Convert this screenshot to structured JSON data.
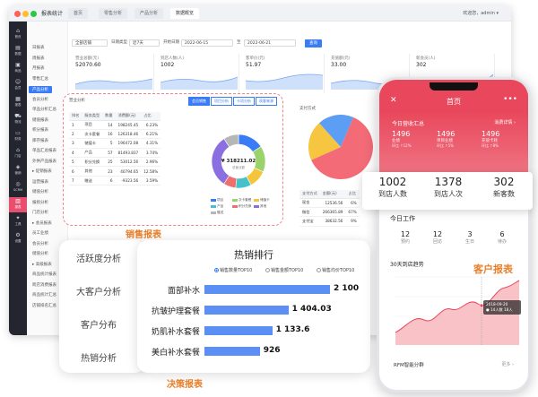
{
  "window": {
    "app_title": "报表统计",
    "tabs": [
      "首页",
      "零售分析",
      "产品分析",
      "数据概览"
    ],
    "user": "欢迎您，admin ▾",
    "colors": {
      "accent": "#3a7bf6",
      "sidebar": "#23262e",
      "sidebar_active": "#e84f6f"
    }
  },
  "sidebar": {
    "items": [
      {
        "icon": "home-icon",
        "glyph": "⌂",
        "label": "首页"
      },
      {
        "icon": "chart-icon",
        "glyph": "▤",
        "label": "数据"
      },
      {
        "icon": "cart-icon",
        "glyph": "▣",
        "label": "商品"
      },
      {
        "icon": "users-icon",
        "glyph": "☺",
        "label": "会员"
      },
      {
        "icon": "doc-icon",
        "glyph": "▦",
        "label": "报表"
      },
      {
        "icon": "truck-icon",
        "glyph": "⛟",
        "label": "物流"
      },
      {
        "icon": "card-icon",
        "glyph": "▭",
        "label": "财务"
      },
      {
        "icon": "shop-icon",
        "glyph": "⌂",
        "label": "门店"
      },
      {
        "icon": "tag-icon",
        "glyph": "◈",
        "label": "营销"
      },
      {
        "icon": "crm-icon",
        "glyph": "◎",
        "label": "SCRM"
      },
      {
        "icon": "report-icon",
        "glyph": "▥",
        "label": "报表"
      },
      {
        "icon": "tool-icon",
        "glyph": "✦",
        "label": "工具"
      },
      {
        "icon": "gear-icon",
        "glyph": "⚙",
        "label": "设置"
      }
    ],
    "active_index": 10
  },
  "subnav": {
    "items": [
      "日报表",
      "周报表",
      "月报表",
      "零售汇总",
      "产品分析",
      "会员分析",
      "单品分析汇总",
      "储值报表",
      "积分报表",
      "库存报表",
      "单品汇总报表",
      "外供产品报表",
      "▸ 促销报表",
      "运营报表",
      "储值分析",
      "报损分析",
      "门店分析",
      "▸ 会员报表",
      "员工业绩",
      "会员分析",
      "储值分析",
      "▸ 高级报表",
      "商品统计报表",
      "跨店消费报表",
      "商品统计汇总",
      "店铺排名汇总"
    ],
    "active_index": 4
  },
  "filters": {
    "shop": "全部店铺",
    "period_label": "日期类型",
    "period": "近7天",
    "date_label": "开始日期",
    "start": "2022-06-15",
    "end_label": "至",
    "end": "2022-06-21",
    "query": "查询"
  },
  "kpis": [
    {
      "title": "营业总额(元)",
      "value": "52070.60"
    },
    {
      "title": "到店人数(人)",
      "value": "1002"
    },
    {
      "title": "客单价(元)",
      "value": "51.97"
    },
    {
      "title": "充值额(元)",
      "value": "33.00"
    },
    {
      "title": "新会员(人)",
      "value": "302"
    }
  ],
  "sales": {
    "title": "营业分析",
    "tabs": [
      "会员销售",
      "项目分析",
      "卡项分析",
      "获客来源"
    ],
    "columns": [
      "排名",
      "服务类型",
      "数量",
      "消费额(元)",
      "占比"
    ],
    "rows": [
      [
        "1",
        "项目",
        "14",
        "198245.45",
        "6.23%"
      ],
      [
        "2",
        "次卡套餐",
        "16",
        "126318.46",
        "6.21%"
      ],
      [
        "3",
        "储值卡",
        "5",
        "196472.08",
        "4.31%"
      ],
      [
        "4",
        "产品",
        "57",
        "81493.837",
        "3.74%"
      ],
      [
        "5",
        "积分兑换",
        "25",
        "53012.56",
        "2.96%"
      ],
      [
        "6",
        "其他",
        "23",
        "40794.65",
        "12.58%"
      ],
      [
        "7",
        "赠送",
        "6",
        "-9323.56",
        "3.59%"
      ]
    ],
    "donut_center": "¥ 318211.02",
    "donut_sub": "总营业额",
    "legend": [
      {
        "label": "项目",
        "color": "#3a7bf6"
      },
      {
        "label": "次卡套餐",
        "color": "#9ad36a"
      },
      {
        "label": "储值卡",
        "color": "#f4c43a"
      },
      {
        "label": "产品",
        "color": "#45c1c9"
      },
      {
        "label": "积分兑换",
        "color": "#ef6f6c"
      },
      {
        "label": "其他",
        "color": "#8b6fe0"
      },
      {
        "label": "赠送",
        "color": "#b6b6b6"
      }
    ]
  },
  "pay_table": {
    "title": "支付方式",
    "columns": [
      "支付方式",
      "金额(元)",
      "占比"
    ],
    "rows": [
      [
        "现金",
        "12536.56",
        "6%"
      ],
      [
        "微信",
        "266365.89",
        "67%"
      ],
      [
        "支付宝",
        "38632.56",
        "9%"
      ]
    ]
  },
  "labels": {
    "sales_report": "销售报表",
    "decision_report": "决策报表",
    "customer_report": "客户报表"
  },
  "menu": [
    "活跃度分析",
    "大客户分析",
    "客户分布",
    "热销分析"
  ],
  "hot": {
    "title": "热销排行",
    "options": [
      {
        "label": "销售数量TOP10",
        "on": true
      },
      {
        "label": "销售金额TOP10",
        "on": false
      },
      {
        "label": "销售均价TOP10",
        "on": false
      }
    ],
    "items": [
      {
        "name": "面部补水",
        "value": 2100,
        "label": "2 100"
      },
      {
        "name": "抗皱护理套餐",
        "value": 1404.03,
        "label": "1 404.03"
      },
      {
        "name": "奶肌补水套餐",
        "value": 1133.6,
        "label": "1 133.6"
      },
      {
        "name": "美白补水套餐",
        "value": 926,
        "label": "926"
      }
    ]
  },
  "phone": {
    "title": "首页",
    "close": "✕",
    "more": "•••",
    "summary_title": "今日营收汇总",
    "summary_link": "消费详情 ›",
    "summary": [
      {
        "n": "1496",
        "s": "业绩",
        "q": "环比 ↑12%"
      },
      {
        "n": "1496",
        "s": "项目业绩",
        "q": "环比 ↑5%"
      },
      {
        "n": "1496",
        "s": "充值卡耗",
        "q": "环比 ↑8%"
      }
    ],
    "stats": [
      {
        "n": "1002",
        "l": "到店人数"
      },
      {
        "n": "1378",
        "l": "到店人次"
      },
      {
        "n": "302",
        "l": "新客数"
      }
    ],
    "today_title": "今日工作",
    "today": [
      {
        "n": "12",
        "l": "预约"
      },
      {
        "n": "12",
        "l": "回访"
      },
      {
        "n": "3",
        "l": "生日"
      },
      {
        "n": "6",
        "l": "待办"
      }
    ],
    "trend_title": "30天到店趋势",
    "tooltip": [
      "2018-09-20",
      "● 14人数 18人"
    ],
    "rfm": "RFM智能分群",
    "rfm_more": "更多 ›"
  }
}
